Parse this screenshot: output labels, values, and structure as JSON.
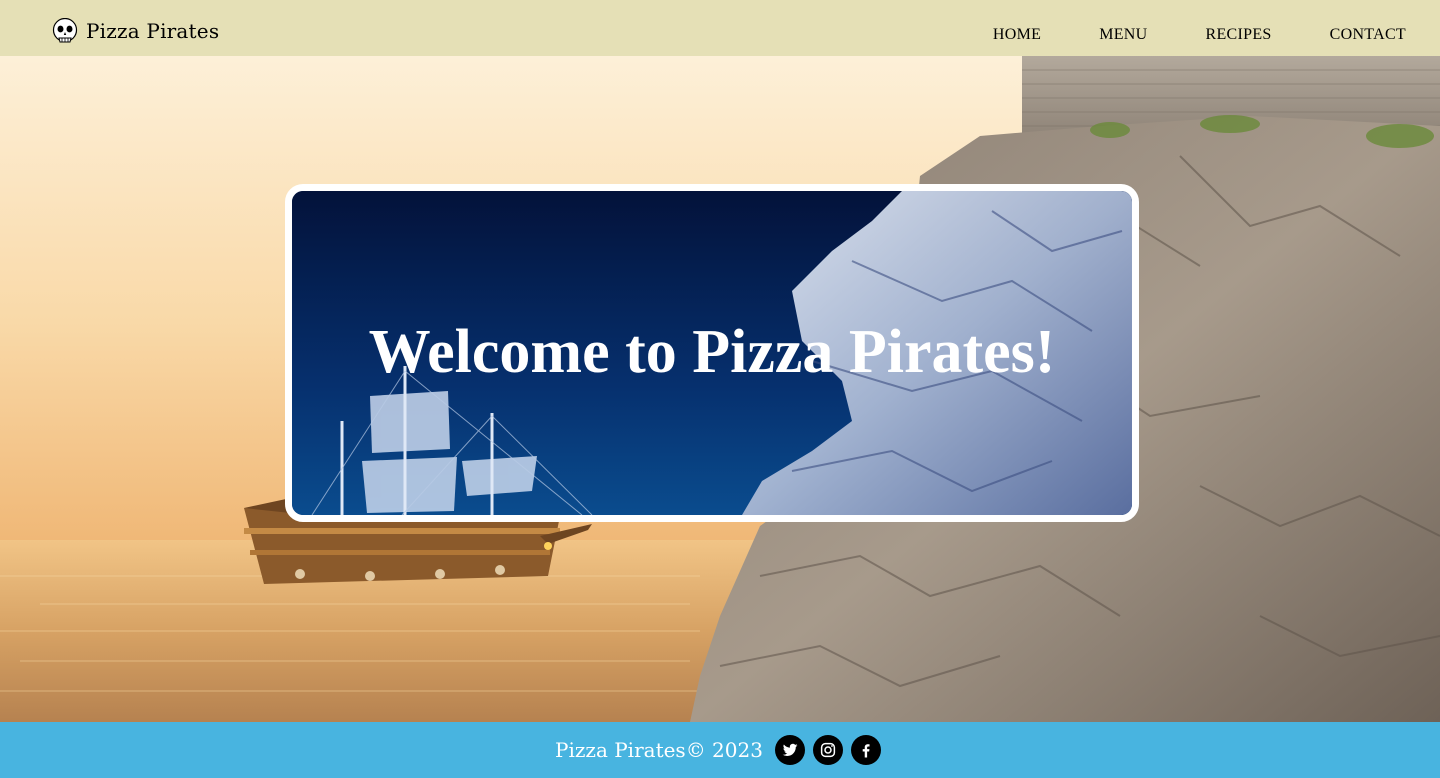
{
  "header": {
    "brand_name": "Pizza Pirates",
    "brand_icon": "pirate-skull-icon",
    "nav": [
      {
        "label": "HOME"
      },
      {
        "label": "MENU"
      },
      {
        "label": "RECIPES"
      },
      {
        "label": "CONTACT"
      }
    ]
  },
  "hero": {
    "background_scene": "pirate ship at sunset beside rocky cliff with stone fortress",
    "welcome_title": "Welcome to Pizza Pirates!"
  },
  "footer": {
    "text": "Pizza Pirates© 2023",
    "social": [
      {
        "icon": "twitter-icon"
      },
      {
        "icon": "instagram-icon"
      },
      {
        "icon": "facebook-icon"
      }
    ]
  },
  "colors": {
    "header_bg": "#e5e0b6",
    "footer_bg": "#48b4e0",
    "card_bg": "#062b62",
    "card_border": "#ffffff",
    "text_dark": "#000000",
    "text_light": "#ffffff"
  }
}
